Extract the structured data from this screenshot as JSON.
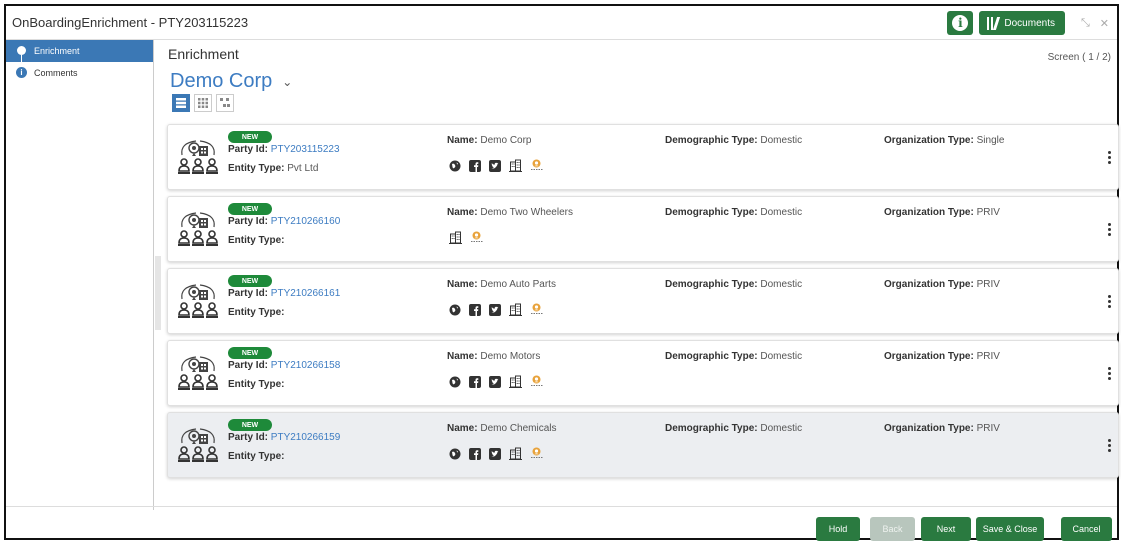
{
  "window": {
    "title": "OnBoardingEnrichment - PTY203115223",
    "docs_label": "Documents",
    "info_icon": "info-icon",
    "minimize_icon": "shrink-icon",
    "close_icon": "close-icon"
  },
  "sidebar": {
    "items": [
      {
        "label": "Enrichment",
        "active": true
      },
      {
        "label": "Comments",
        "active": false
      }
    ]
  },
  "main": {
    "section_title": "Enrichment",
    "screen_indicator": "Screen ( 1 / 2)",
    "party_name": "Demo Corp",
    "view_toggles": [
      "list-view-icon",
      "grid-view-icon",
      "hierarchy-view-icon"
    ]
  },
  "labels": {
    "new": "NEW",
    "party_id": "Party Id:",
    "entity_type": "Entity Type:",
    "name": "Name:",
    "demographic_type": "Demographic Type:",
    "organization_type": "Organization Type:"
  },
  "cards": [
    {
      "party_id": "PTY203115223",
      "entity_type": "Pvt Ltd",
      "name": "Demo Corp",
      "demographic_type": "Domestic",
      "organization_type": "Single",
      "icons": [
        "globe",
        "facebook",
        "twitter",
        "building",
        "person"
      ]
    },
    {
      "party_id": "PTY210266160",
      "entity_type": "",
      "name": "Demo Two Wheelers",
      "demographic_type": "Domestic",
      "organization_type": "PRIV",
      "icons": [
        "building",
        "person"
      ]
    },
    {
      "party_id": "PTY210266161",
      "entity_type": "",
      "name": "Demo Auto Parts",
      "demographic_type": "Domestic",
      "organization_type": "PRIV",
      "icons": [
        "globe",
        "facebook",
        "twitter",
        "building",
        "person"
      ]
    },
    {
      "party_id": "PTY210266158",
      "entity_type": "",
      "name": "Demo Motors",
      "demographic_type": "Domestic",
      "organization_type": "PRIV",
      "icons": [
        "globe",
        "facebook",
        "twitter",
        "building",
        "person"
      ]
    },
    {
      "party_id": "PTY210266159",
      "entity_type": "",
      "name": "Demo Chemicals",
      "demographic_type": "Domestic",
      "organization_type": "PRIV",
      "icons": [
        "globe",
        "facebook",
        "twitter",
        "building",
        "person"
      ]
    }
  ],
  "footer": {
    "hold": "Hold",
    "back": "Back",
    "next": "Next",
    "save_close": "Save & Close",
    "cancel": "Cancel"
  },
  "colors": {
    "accent_green": "#2a7a40",
    "link_blue": "#3d7cc2",
    "active_blue": "#3b78b5"
  }
}
